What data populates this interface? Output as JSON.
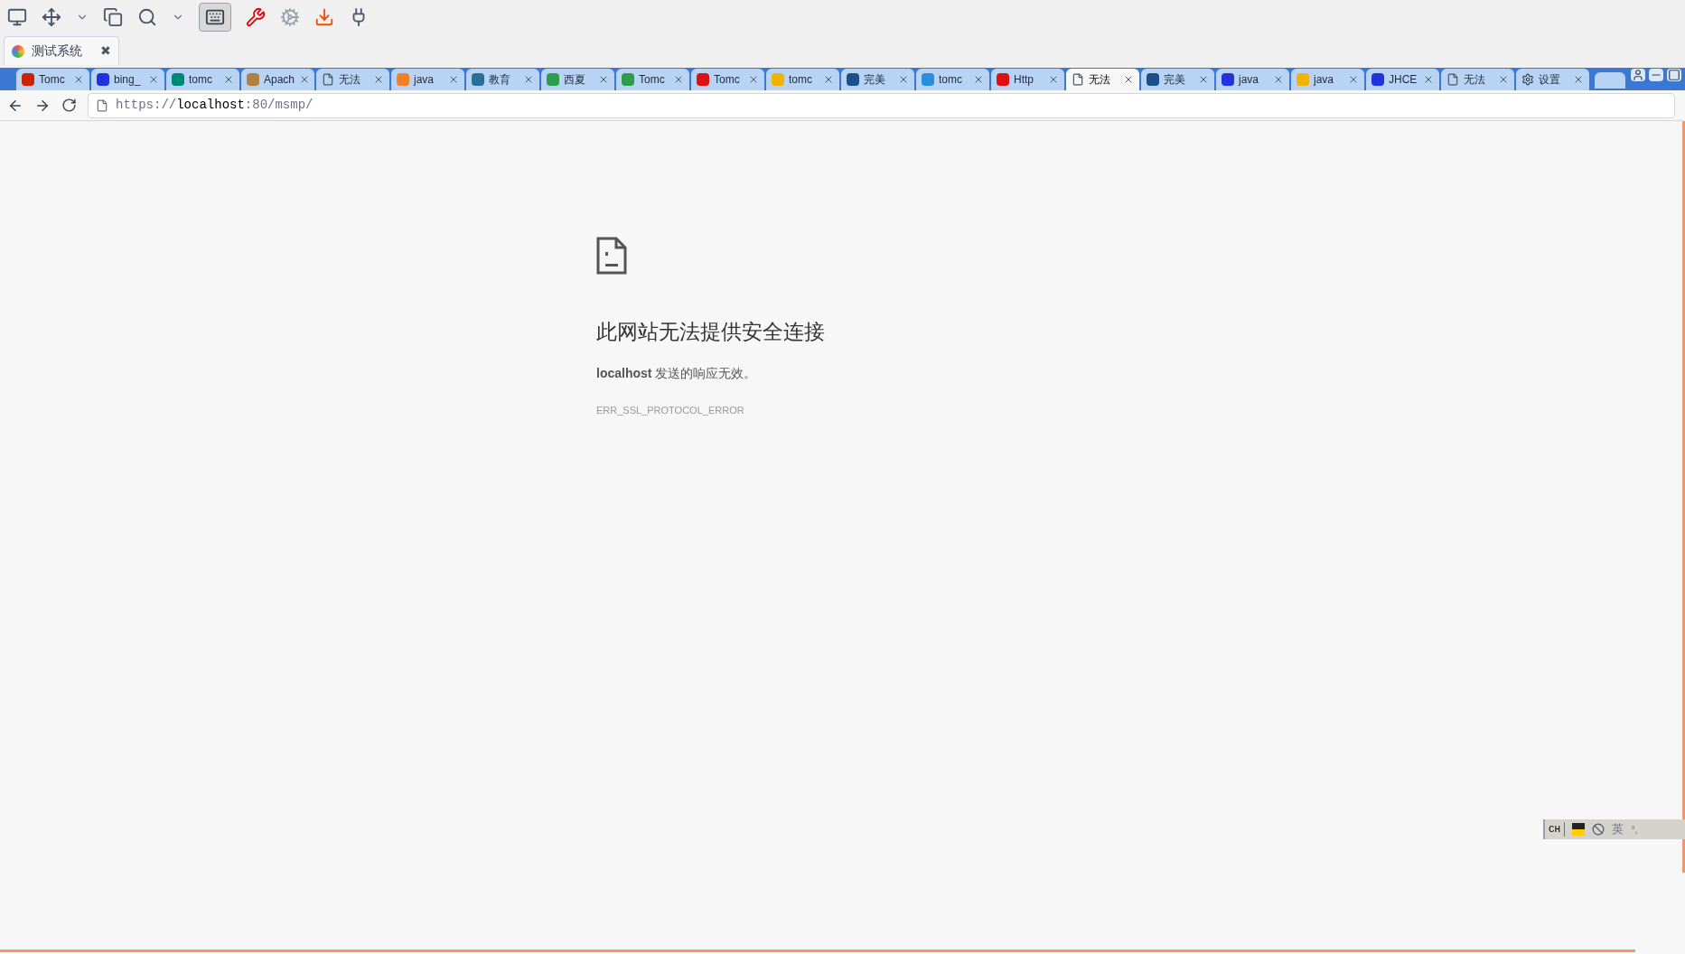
{
  "app_tab": {
    "title": "测试系统",
    "close": "✖"
  },
  "browser_tabs": [
    {
      "label": "Tomc",
      "kind": "site",
      "color": "#cc2200",
      "selected": false
    },
    {
      "label": "bing_",
      "kind": "site",
      "color": "#2233dd",
      "selected": false
    },
    {
      "label": "tomc",
      "kind": "site",
      "color": "#00897b",
      "selected": false
    },
    {
      "label": "Apach",
      "kind": "site",
      "color": "#b08040",
      "selected": false
    },
    {
      "label": "无法",
      "kind": "page",
      "selected": false
    },
    {
      "label": "java",
      "kind": "site",
      "color": "#f48024",
      "selected": false
    },
    {
      "label": "教育",
      "kind": "site",
      "color": "#2a6f97",
      "selected": false
    },
    {
      "label": "西夏",
      "kind": "site",
      "color": "#2e9e4a",
      "selected": false
    },
    {
      "label": "Tomc",
      "kind": "site",
      "color": "#2e9e4a",
      "selected": false
    },
    {
      "label": "Tomc",
      "kind": "site",
      "color": "#dd1111",
      "selected": false
    },
    {
      "label": "tomc",
      "kind": "site",
      "color": "#f0b400",
      "selected": false
    },
    {
      "label": "完美",
      "kind": "site",
      "color": "#1b4f8a",
      "selected": false
    },
    {
      "label": "tomc",
      "kind": "site",
      "color": "#2a8fd8",
      "selected": false
    },
    {
      "label": "Http",
      "kind": "site",
      "color": "#dd1111",
      "selected": false
    },
    {
      "label": "无法",
      "kind": "page",
      "selected": true
    },
    {
      "label": "完美",
      "kind": "site",
      "color": "#1b4f8a",
      "selected": false
    },
    {
      "label": "java",
      "kind": "site",
      "color": "#2233dd",
      "selected": false
    },
    {
      "label": "java",
      "kind": "site",
      "color": "#f0b400",
      "selected": false
    },
    {
      "label": "JHCE",
      "kind": "site",
      "color": "#2233dd",
      "selected": false
    },
    {
      "label": "无法",
      "kind": "page",
      "selected": false
    },
    {
      "label": "设置",
      "kind": "gear",
      "selected": false
    }
  ],
  "address": {
    "scheme": "https://",
    "host": "localhost",
    "rest": ":80/msmp/"
  },
  "error": {
    "title": "此网站无法提供安全连接",
    "host": "localhost",
    "message": "发送的响应无效。",
    "code": "ERR_SSL_PROTOCOL_ERROR"
  },
  "ime_bar": {
    "lang": "CH",
    "mode": "英",
    "punct": "°,"
  }
}
